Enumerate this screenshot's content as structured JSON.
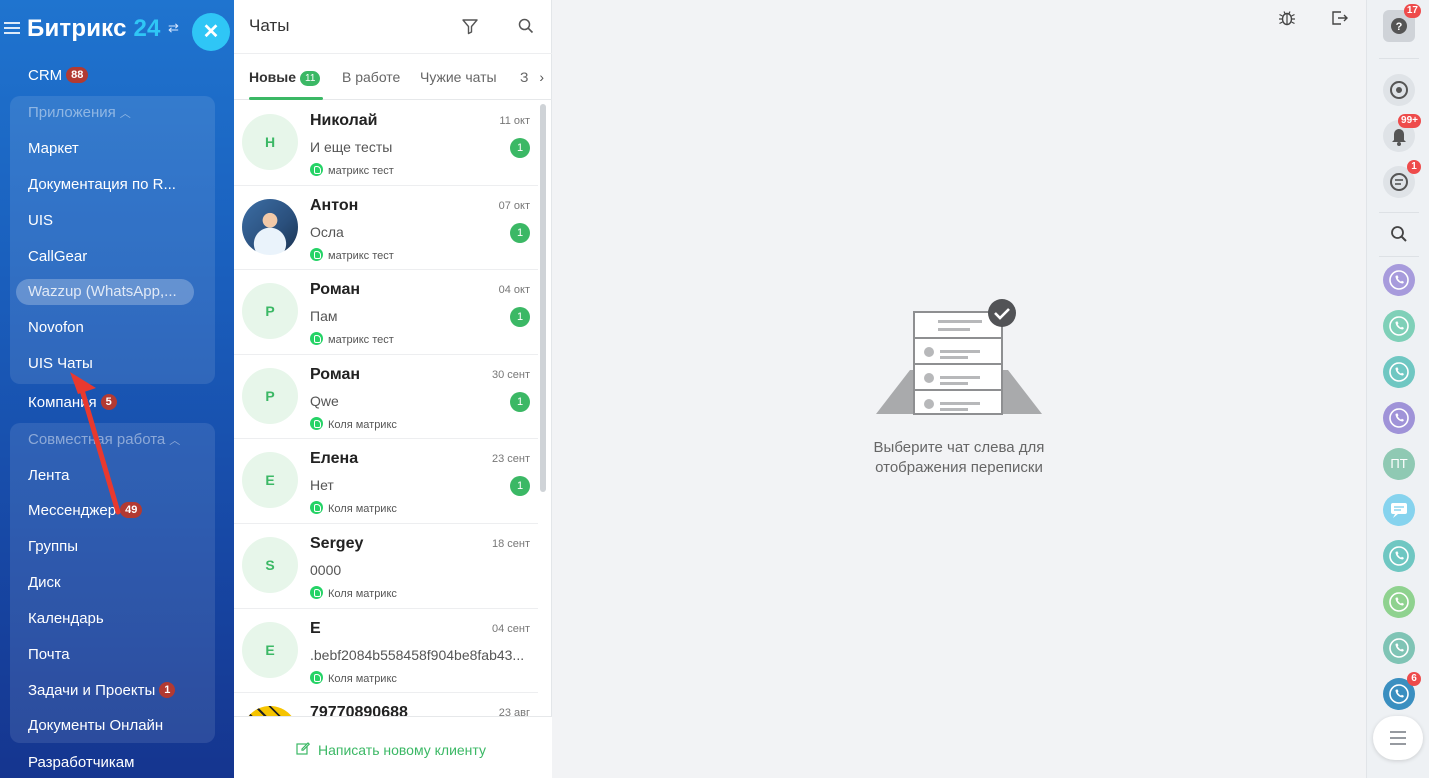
{
  "sidebar": {
    "logo": {
      "text": "Битрикс",
      "number": "24"
    },
    "items_top": [
      {
        "label": "CRM",
        "badge": "88"
      }
    ],
    "apps_group": {
      "title": "Приложения",
      "items": [
        "Маркет",
        "Документация по R...",
        "UIS",
        "CallGear",
        "Wazzup (WhatsApp,...",
        "Novofon",
        "UIS Чаты"
      ],
      "active": "Wazzup (WhatsApp,..."
    },
    "company": {
      "label": "Компания",
      "badge": "5"
    },
    "collab_group": {
      "title": "Совместная работа",
      "items": [
        {
          "label": "Лента",
          "badge": ""
        },
        {
          "label": "Мессенджер",
          "badge": "49"
        },
        {
          "label": "Группы",
          "badge": ""
        },
        {
          "label": "Диск",
          "badge": ""
        },
        {
          "label": "Календарь",
          "badge": ""
        },
        {
          "label": "Почта",
          "badge": ""
        },
        {
          "label": "Задачи и Проекты",
          "badge": "1"
        },
        {
          "label": "Документы Онлайн",
          "badge": ""
        }
      ]
    },
    "developers": "Разработчикам"
  },
  "chats": {
    "title": "Чаты",
    "tabs": [
      {
        "label": "Новые",
        "count": "11"
      },
      {
        "label": "В работе",
        "count": ""
      },
      {
        "label": "Чужие чаты",
        "count": ""
      },
      {
        "label": "З",
        "count": ""
      }
    ],
    "items": [
      {
        "initial": "Н",
        "name": "Николай",
        "date": "11 окт",
        "message": "И еще тесты",
        "unread": "1",
        "source": "матрикс тест",
        "avatar": "letter"
      },
      {
        "initial": "",
        "name": "Антон",
        "date": "07 окт",
        "message": "Осла",
        "unread": "1",
        "source": "матрикс тест",
        "avatar": "photo"
      },
      {
        "initial": "Р",
        "name": "Роман",
        "date": "04 окт",
        "message": "Пам",
        "unread": "1",
        "source": "матрикс тест",
        "avatar": "letter"
      },
      {
        "initial": "Р",
        "name": "Роман",
        "date": "30 сент",
        "message": "Qwe",
        "unread": "1",
        "source": "Коля матрикс",
        "avatar": "letter"
      },
      {
        "initial": "Е",
        "name": "Елена",
        "date": "23 сент",
        "message": "Нет",
        "unread": "1",
        "source": "Коля матрикс",
        "avatar": "letter"
      },
      {
        "initial": "S",
        "name": "Sergey",
        "date": "18 сент",
        "message": "0000",
        "unread": "",
        "source": "Коля матрикс",
        "avatar": "letter"
      },
      {
        "initial": "Е",
        "name": "Е",
        "date": "04 сент",
        "message": ".bebf2084b558458f904be8fab43...",
        "unread": "",
        "source": "Коля матрикс",
        "avatar": "letter"
      },
      {
        "initial": "",
        "name": "79770890688",
        "date": "23 авг",
        "message": "",
        "unread": "",
        "source": "",
        "avatar": "yellow"
      }
    ],
    "new_client": "Написать новому клиенту"
  },
  "main": {
    "empty_text_line1": "Выберите чат слева для",
    "empty_text_line2": "отображения переписки"
  },
  "rightbar": {
    "help_badge": "17",
    "notifications_badge": "99+",
    "chat_badge": "1",
    "bottom_call_badge": "6",
    "contact_initials": "ПТ"
  },
  "colors": {
    "accent_green": "#3bb865",
    "sidebar_blue": "#1a5fbd",
    "badge_red": "#b23a32",
    "logo_cyan": "#2fc6f6",
    "arrow_red": "#e8392f"
  }
}
